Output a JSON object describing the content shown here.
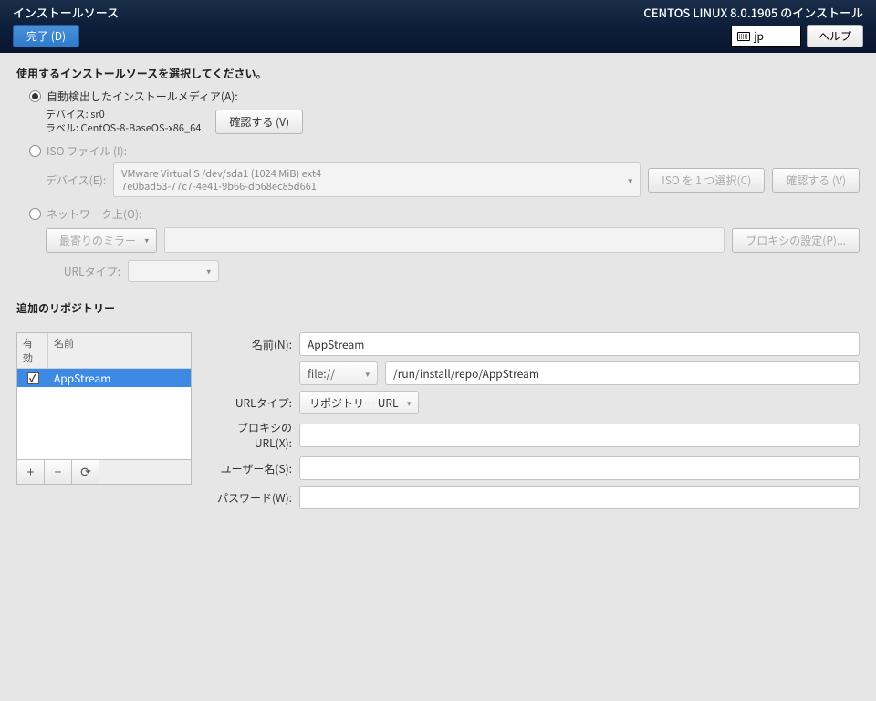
{
  "header": {
    "page_title": "インストールソース",
    "done": "完了 (D)",
    "installer_title": "CENTOS LINUX 8.0.1905 のインストール",
    "lang": "jp",
    "help": "ヘルプ"
  },
  "source": {
    "heading": "使用するインストールソースを選択してください。",
    "auto_label": "自動検出したインストールメディア(A):",
    "device_label": "デバイス:",
    "device_value": "sr0",
    "label_label": "ラベル:",
    "label_value": "CentOS-8-BaseOS-x86_64",
    "verify": "確認する (V)",
    "iso_label": "ISO ファイル (I):",
    "iso_device_label": "デバイス(E):",
    "iso_device_line1": "VMware Virtual S /dev/sda1 (1024 MiB) ext4",
    "iso_device_line2": "7e0bad53-77c7-4e41-9b66-db68ec85d661",
    "choose_iso": "ISO を 1 つ選択(C)",
    "verify2": "確認する (V)",
    "network_label": "ネットワーク上(O):",
    "mirror": "最寄りのミラー",
    "proxy_settings": "プロキシの設定(P)...",
    "url_type_label": "URLタイプ:"
  },
  "repos": {
    "heading": "追加のリポジトリー",
    "col_enabled": "有効",
    "col_name": "名前",
    "items": [
      {
        "enabled": true,
        "name": "AppStream"
      }
    ],
    "add": "+",
    "remove": "−",
    "reload": "⟳",
    "form": {
      "name_label": "名前(N):",
      "name_value": "AppStream",
      "proto": "file://",
      "path": "/run/install/repo/AppStream",
      "url_type_label": "URLタイプ:",
      "url_type_value": "リポジトリー URL",
      "proxy_label": "プロキシの URL(X):",
      "user_label": "ユーザー名(S):",
      "pass_label": "パスワード(W):"
    }
  }
}
